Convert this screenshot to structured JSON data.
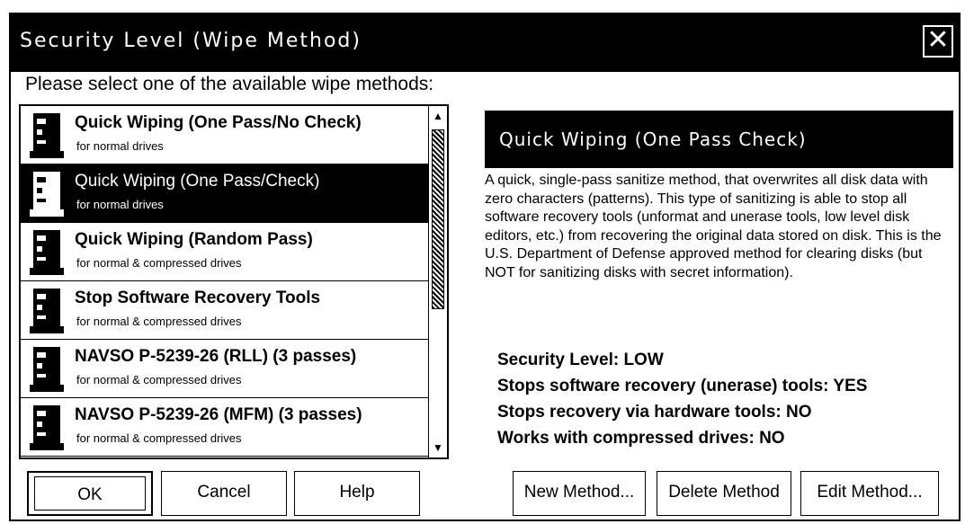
{
  "window": {
    "title": "Security Level (Wipe Method)",
    "close_glyph": "✕"
  },
  "prompt": "Please select one of the available wipe methods:",
  "methods": [
    {
      "title": "Quick Wiping (One Pass/No Check)",
      "subtitle": "for normal drives",
      "selected": false
    },
    {
      "title": "Quick Wiping (One Pass/Check)",
      "subtitle": "for normal drives",
      "selected": true
    },
    {
      "title": "Quick Wiping (Random Pass)",
      "subtitle": "for normal & compressed drives",
      "selected": false
    },
    {
      "title": "Stop Software Recovery Tools",
      "subtitle": "for normal & compressed drives",
      "selected": false
    },
    {
      "title": "NAVSO P-5239-26 (RLL) (3 passes)",
      "subtitle": "for normal & compressed drives",
      "selected": false
    },
    {
      "title": "NAVSO P-5239-26 (MFM) (3 passes)",
      "subtitle": "for normal & compressed drives",
      "selected": false
    }
  ],
  "detail": {
    "title": "Quick Wiping (One Pass Check)",
    "description": "A quick, single-pass sanitize method, that overwrites all disk data with zero characters (patterns). This type of sanitizing is able to stop all software recovery tools (unformat and unerase tools, low level disk editors, etc.) from recovering the original data stored on disk. This is the U.S. Department of Defense approved method for clearing disks (but NOT for sanitizing disks with secret information).",
    "facts": [
      "Security Level: LOW",
      "Stops software recovery (unerase) tools: YES",
      "Stops recovery via hardware tools: NO",
      "Works with compressed drives: NO"
    ]
  },
  "buttons": {
    "ok": "OK",
    "cancel": "Cancel",
    "help": "Help",
    "new_method": "New Method...",
    "delete_method": "Delete Method",
    "edit_method": "Edit Method..."
  },
  "icons": {
    "method_icon": "drive-icon",
    "scroll_up": "▲",
    "scroll_down": "▼"
  }
}
